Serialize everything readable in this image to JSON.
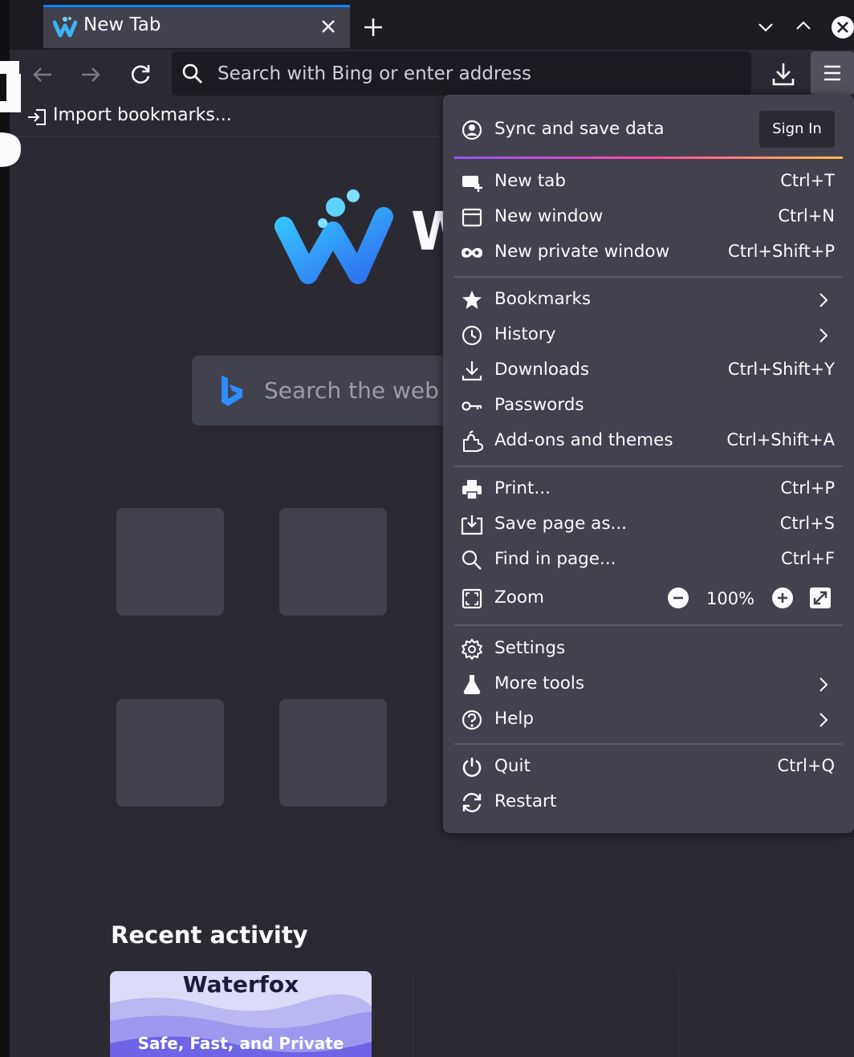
{
  "tab": {
    "title": "New Tab"
  },
  "urlbar": {
    "placeholder": "Search with Bing or enter address"
  },
  "bookmarks_bar": {
    "import_label": "Import bookmarks..."
  },
  "newtab": {
    "brand_text": "W",
    "search_placeholder": "Search the web",
    "recent_heading": "Recent activity",
    "recent_card": {
      "title": "Waterfox",
      "tagline": "Safe, Fast, and Private"
    }
  },
  "menu": {
    "sync_label": "Sync and save data",
    "sign_in": "Sign In",
    "items": [
      {
        "label": "New tab",
        "shortcut": "Ctrl+T",
        "icon": "new-tab-icon"
      },
      {
        "label": "New window",
        "shortcut": "Ctrl+N",
        "icon": "new-window-icon"
      },
      {
        "label": "New private window",
        "shortcut": "Ctrl+Shift+P",
        "icon": "private-mask-icon"
      },
      {
        "label": "Bookmarks",
        "shortcut": "",
        "icon": "star-icon"
      },
      {
        "label": "History",
        "shortcut": "",
        "icon": "clock-icon"
      },
      {
        "label": "Downloads",
        "shortcut": "Ctrl+Shift+Y",
        "icon": "download-icon"
      },
      {
        "label": "Passwords",
        "shortcut": "",
        "icon": "key-icon"
      },
      {
        "label": "Add-ons and themes",
        "shortcut": "Ctrl+Shift+A",
        "icon": "puzzle-icon"
      },
      {
        "label": "Print...",
        "shortcut": "Ctrl+P",
        "icon": "printer-icon"
      },
      {
        "label": "Save page as...",
        "shortcut": "Ctrl+S",
        "icon": "save-icon"
      },
      {
        "label": "Find in page...",
        "shortcut": "Ctrl+F",
        "icon": "search-icon"
      },
      {
        "label": "Zoom",
        "shortcut": "",
        "icon": "zoom-icon"
      },
      {
        "label": "Settings",
        "shortcut": "",
        "icon": "gear-icon"
      },
      {
        "label": "More tools",
        "shortcut": "",
        "icon": "flask-icon"
      },
      {
        "label": "Help",
        "shortcut": "",
        "icon": "help-icon"
      },
      {
        "label": "Quit",
        "shortcut": "Ctrl+Q",
        "icon": "power-icon"
      },
      {
        "label": "Restart",
        "shortcut": "",
        "icon": "restart-icon"
      }
    ],
    "zoom_value": "100%"
  },
  "colors": {
    "accent": "#0a84ff",
    "background": "#2b2a33",
    "menu_bg": "#42414d"
  }
}
